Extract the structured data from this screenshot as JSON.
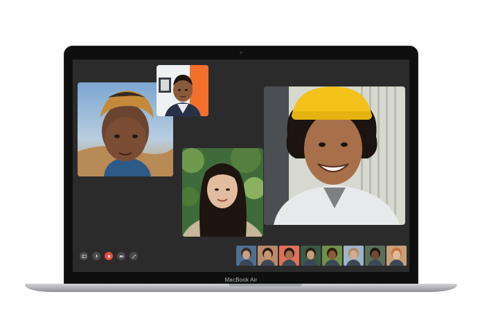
{
  "device": {
    "label": "MacBook Air"
  },
  "facetime": {
    "participants": [
      {
        "id": "woman-headwrap",
        "bg": "#8ab0cf"
      },
      {
        "id": "man-orange-wall",
        "bg": "#f26f2c"
      },
      {
        "id": "woman-greenery",
        "bg": "#3f6b3a"
      },
      {
        "id": "man-yellow-beanie",
        "bg": "#cfd0c9"
      }
    ],
    "controls": [
      {
        "name": "sidebar-button-icon"
      },
      {
        "name": "mute-microphone-icon"
      },
      {
        "name": "end-call-icon"
      },
      {
        "name": "camera-toggle-icon"
      },
      {
        "name": "fullscreen-icon"
      }
    ],
    "thumbnails": [
      {
        "bg": "#4f6f90",
        "skin": "#c9a187",
        "hair": "#3b2a20"
      },
      {
        "bg": "#b98b6a",
        "skin": "#c7966f",
        "hair": "#2b1d15"
      },
      {
        "bg": "#e0705a",
        "skin": "#a6704c",
        "hair": "#261a12"
      },
      {
        "bg": "#3a5a44",
        "skin": "#c99c7c",
        "hair": "#2a1c14"
      },
      {
        "bg": "#6f8f4a",
        "skin": "#8a5b3c",
        "hair": "#2b1d14"
      },
      {
        "bg": "#9eb4c8",
        "skin": "#d3ad90",
        "hair": "#b08a5c"
      },
      {
        "bg": "#5a6f5a",
        "skin": "#6e4a30",
        "hair": "#1d1410"
      },
      {
        "bg": "#c7a07a",
        "skin": "#e1b998",
        "hair": "#c8733a"
      }
    ]
  },
  "colors": {
    "screen_bg": "#2b2b2c",
    "bezel": "#0f0f10",
    "end_call": "#e5483f",
    "control_bg": "#4a4a4c"
  }
}
